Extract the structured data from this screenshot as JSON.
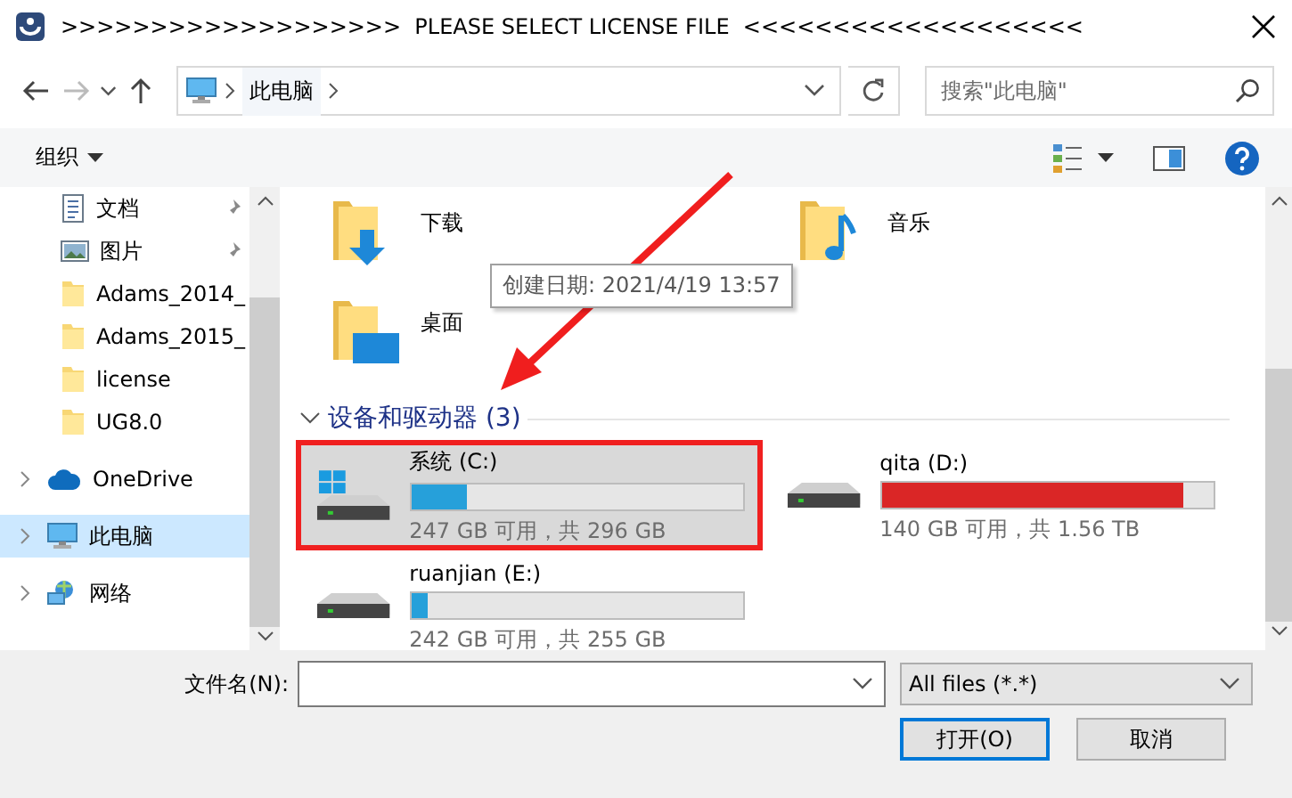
{
  "window": {
    "title": ">>>>>>>>>>>>>>>>>>>  PLEASE SELECT LICENSE FILE  <<<<<<<<<<<<<<<<<<<"
  },
  "nav": {
    "back_disabled": false,
    "forward_disabled": true
  },
  "address": {
    "path": [
      "此电脑"
    ]
  },
  "search": {
    "placeholder": "搜索\"此电脑\""
  },
  "toolbar": {
    "organize": "组织"
  },
  "sidebar": {
    "items": [
      {
        "label": "文档",
        "kind": "document",
        "pinned": true,
        "expandable": false,
        "selected": false
      },
      {
        "label": "图片",
        "kind": "pictures",
        "pinned": true,
        "expandable": false,
        "selected": false
      },
      {
        "label": "Adams_2014_",
        "kind": "folder",
        "pinned": false,
        "expandable": false,
        "selected": false
      },
      {
        "label": "Adams_2015_",
        "kind": "folder",
        "pinned": false,
        "expandable": false,
        "selected": false
      },
      {
        "label": "license",
        "kind": "folder",
        "pinned": false,
        "expandable": false,
        "selected": false
      },
      {
        "label": "UG8.0",
        "kind": "folder",
        "pinned": false,
        "expandable": false,
        "selected": false
      },
      {
        "label": "OneDrive",
        "kind": "cloud",
        "pinned": false,
        "expandable": true,
        "selected": false
      },
      {
        "label": "此电脑",
        "kind": "computer",
        "pinned": false,
        "expandable": true,
        "selected": true
      },
      {
        "label": "网络",
        "kind": "network",
        "pinned": false,
        "expandable": true,
        "selected": false
      }
    ]
  },
  "main": {
    "folders": [
      {
        "label": "下载",
        "kind": "downloads"
      },
      {
        "label": "音乐",
        "kind": "music"
      },
      {
        "label": "桌面",
        "kind": "desktop"
      }
    ],
    "tooltip": "创建日期: 2021/4/19 13:57",
    "group": {
      "title": "设备和驱动器 (3)",
      "expanded": true
    },
    "drives": [
      {
        "name": "系统 (C:)",
        "kind": "system",
        "level": 0.17,
        "low_space": false,
        "free": "247 GB 可用，共 296 GB",
        "selected": true,
        "highlighted": true
      },
      {
        "name": "qita (D:)",
        "kind": "disk",
        "level": 0.91,
        "low_space": true,
        "free": "140 GB 可用，共 1.56 TB",
        "selected": false,
        "highlighted": false
      },
      {
        "name": "ruanjian (E:)",
        "kind": "disk",
        "level": 0.05,
        "low_space": false,
        "free": "242 GB 可用，共 255 GB",
        "selected": false,
        "highlighted": false
      }
    ]
  },
  "footer": {
    "filename_label": "文件名(N):",
    "filter": "All files (*.*)",
    "buttons": [
      {
        "label": "打开(O)",
        "default": true
      },
      {
        "label": "取消",
        "default": false
      }
    ]
  }
}
